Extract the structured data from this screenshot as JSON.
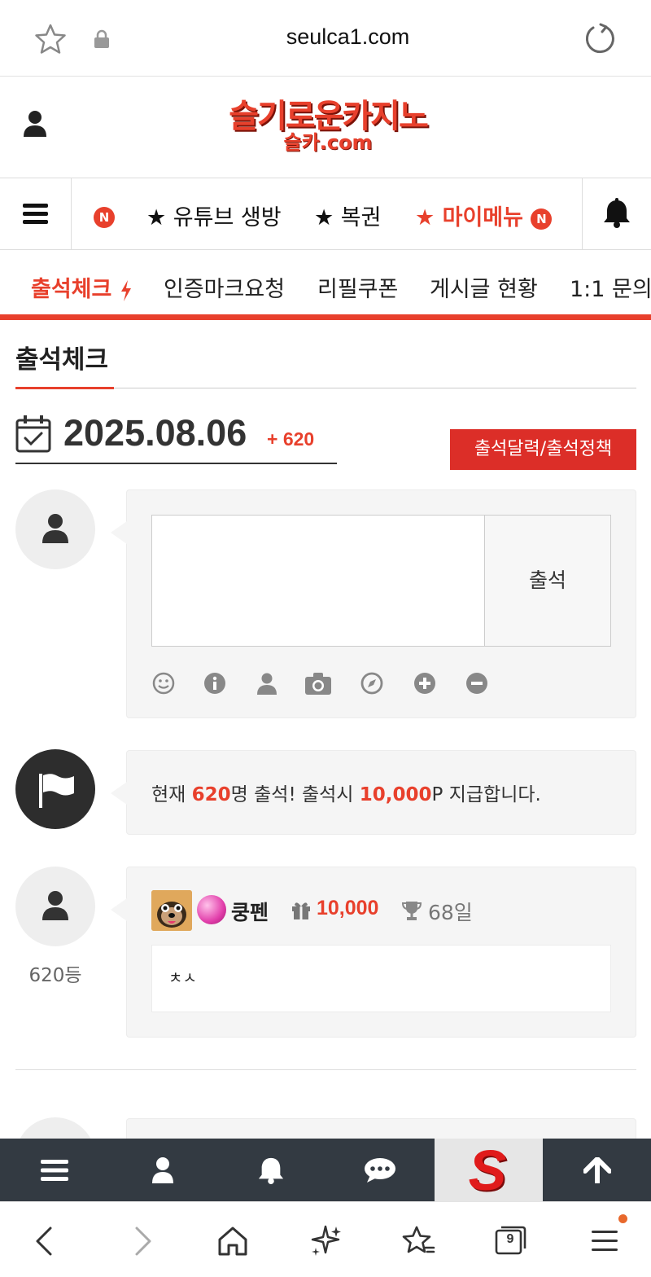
{
  "browser": {
    "url": "seulca1.com",
    "tab_count": "9"
  },
  "header": {
    "logo_line1": "슬기로운카지노",
    "logo_line2": "슬카.com"
  },
  "nav": {
    "items": [
      {
        "label": "★ 유튜브 생방"
      },
      {
        "label": "★ 복권"
      },
      {
        "label": "★ 마이메뉴"
      }
    ],
    "badge": "N"
  },
  "subtabs": [
    {
      "label": "출석체크"
    },
    {
      "label": "인증마크요청"
    },
    {
      "label": "리필쿠폰"
    },
    {
      "label": "게시글 현황"
    },
    {
      "label": "1:1 문의"
    }
  ],
  "page": {
    "title": "출석체크",
    "date": "2025.08.06",
    "count_plus": "+ 620",
    "policy_button": "출석달력/출석정책"
  },
  "form": {
    "submit_label": "출석",
    "textarea_value": ""
  },
  "notice": {
    "prefix": "현재 ",
    "count": "620",
    "middle": "명 출석! 출석시 ",
    "points": "10,000",
    "suffix": "P 지급합니다."
  },
  "entries": [
    {
      "rank": "620등",
      "username": "쿵펜",
      "points": "10,000",
      "days": "68일",
      "comment": "ㅊㅅ"
    }
  ],
  "colors": {
    "accent": "#e8402c",
    "toolbar": "#333a42"
  }
}
